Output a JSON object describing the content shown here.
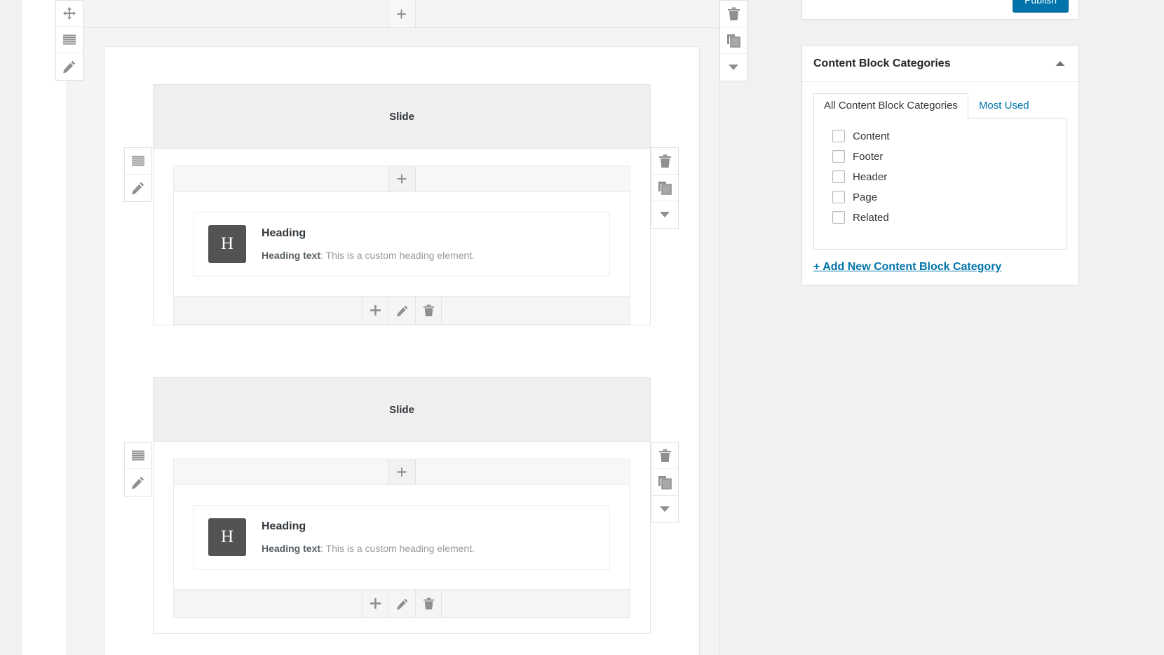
{
  "app": {
    "context": "wordpress-page-builder"
  },
  "colors": {
    "accent": "#0073aa",
    "link": "#0073aa",
    "icon_gray": "#8f8f8f",
    "element_icon_bg": "#535353",
    "panel_bg": "#f1f1f1",
    "slide_header_bg": "#efefef"
  },
  "outer_toolbar_left": {
    "buttons": [
      {
        "name": "move-icon",
        "label": "Move"
      },
      {
        "name": "rows-icon",
        "label": "Rows"
      },
      {
        "name": "pencil-icon",
        "label": "Edit"
      }
    ]
  },
  "outer_toolbar_right": {
    "buttons": [
      {
        "name": "trash-icon",
        "label": "Delete"
      },
      {
        "name": "duplicate-icon",
        "label": "Duplicate"
      },
      {
        "name": "chevron-down-icon",
        "label": "More"
      }
    ]
  },
  "inner_toolbar_left": {
    "buttons": [
      {
        "name": "rows-icon",
        "label": "Rows"
      },
      {
        "name": "pencil-icon",
        "label": "Edit"
      }
    ]
  },
  "inner_toolbar_right": {
    "buttons": [
      {
        "name": "trash-icon",
        "label": "Delete"
      },
      {
        "name": "duplicate-icon",
        "label": "Duplicate"
      },
      {
        "name": "chevron-down-icon",
        "label": "More"
      }
    ]
  },
  "add_button": {
    "glyph": "+",
    "label": "Add"
  },
  "element_footer": {
    "buttons": [
      {
        "name": "plus-icon",
        "label": "Add"
      },
      {
        "name": "pencil-icon",
        "label": "Edit"
      },
      {
        "name": "trash-icon",
        "label": "Delete"
      }
    ]
  },
  "slides": [
    {
      "title": "Slide",
      "element": {
        "icon_letter": "H",
        "title": "Heading",
        "desc_label": "Heading text",
        "desc_separator": ": ",
        "desc_text": "This is a custom heading element."
      }
    },
    {
      "title": "Slide",
      "element": {
        "icon_letter": "H",
        "title": "Heading",
        "desc_label": "Heading text",
        "desc_separator": ": ",
        "desc_text": "This is a custom heading element."
      }
    }
  ],
  "sidebar": {
    "publish": {
      "label": "Publish"
    },
    "categories_panel": {
      "title": "Content Block Categories",
      "toggle_icon": "chevron-up-icon",
      "tabs": [
        {
          "label": "All Content Block Categories",
          "active": true
        },
        {
          "label": "Most Used",
          "active": false
        }
      ],
      "items": [
        {
          "label": "Content",
          "checked": false
        },
        {
          "label": "Footer",
          "checked": false
        },
        {
          "label": "Header",
          "checked": false
        },
        {
          "label": "Page",
          "checked": false
        },
        {
          "label": "Related",
          "checked": false
        }
      ],
      "add_link": "+ Add New Content Block Category"
    }
  }
}
